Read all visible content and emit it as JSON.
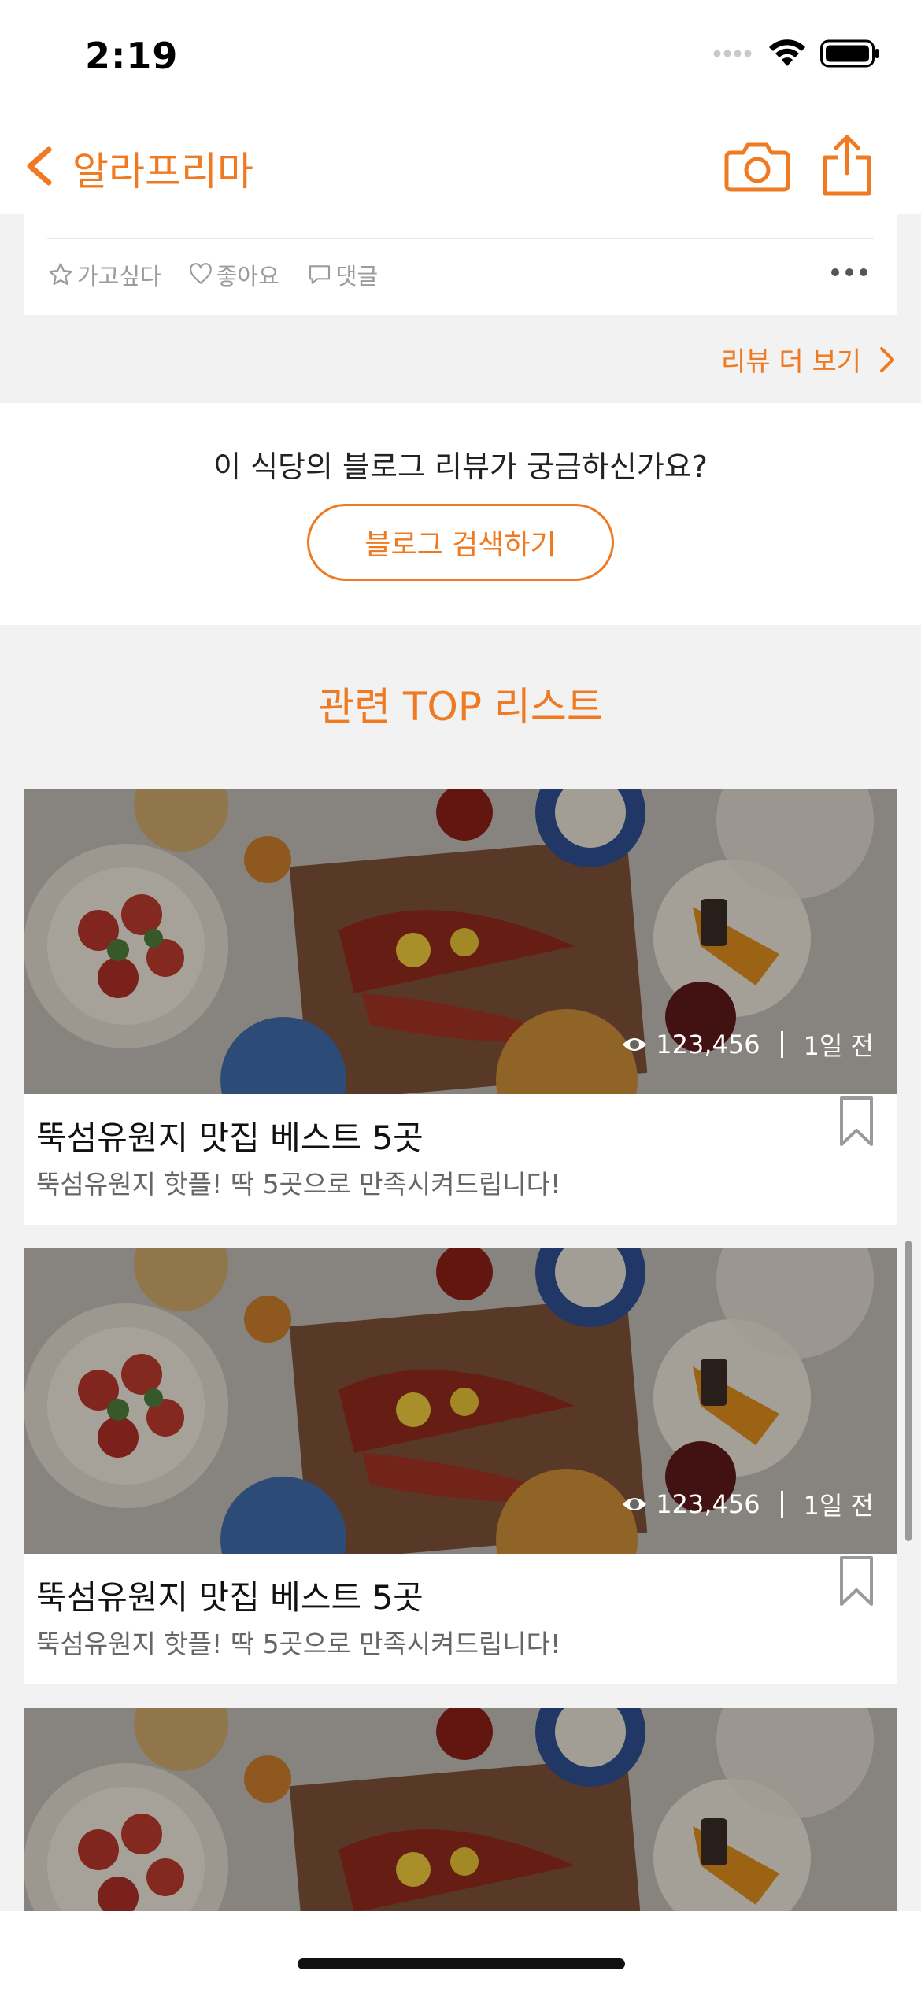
{
  "status_bar": {
    "time": "2:19"
  },
  "nav": {
    "title": "알라프리마",
    "back_icon": "chevron-left-icon",
    "camera_icon": "camera-icon",
    "share_icon": "share-icon",
    "accent": "#ef7a22"
  },
  "review": {
    "actions": [
      {
        "label": "가고싶다",
        "icon": "star-icon"
      },
      {
        "label": "좋아요",
        "icon": "heart-icon"
      },
      {
        "label": "댓글",
        "icon": "comment-icon"
      }
    ],
    "more_reviews_label": "리뷰 더 보기"
  },
  "blog": {
    "question": "이 식당의 블로그 리뷰가 궁금하신가요?",
    "button_label": "블로그 검색하기"
  },
  "top_list": {
    "title": "관련 TOP 리스트",
    "items": [
      {
        "title": "뚝섬유원지 맛집 베스트 5곳",
        "description": "뚝섬유원지 핫플! 딱 5곳으로 만족시켜드립니다!",
        "views": "123,456",
        "time": "1일 전"
      },
      {
        "title": "뚝섬유원지 맛집 베스트 5곳",
        "description": "뚝섬유원지 핫플! 딱 5곳으로 만족시켜드립니다!",
        "views": "123,456",
        "time": "1일 전"
      },
      {
        "title": "",
        "description": "",
        "views": "",
        "time": ""
      }
    ]
  }
}
